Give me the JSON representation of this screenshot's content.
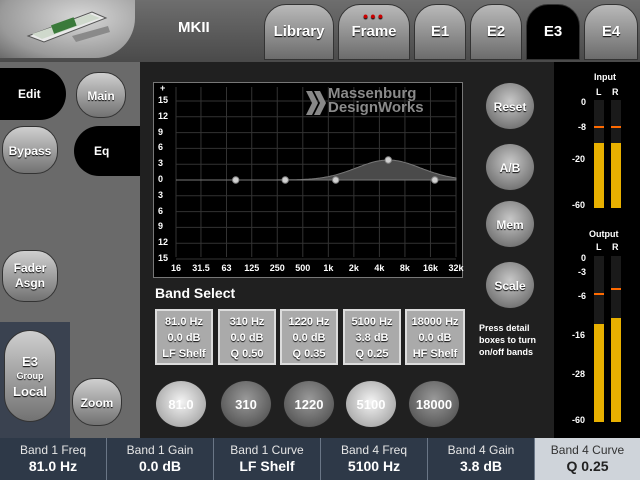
{
  "header": {
    "title": "MKII",
    "tabs": [
      {
        "label": "Library"
      },
      {
        "label": "Frame"
      },
      {
        "label": "E1"
      },
      {
        "label": "E2"
      },
      {
        "label": "E3"
      },
      {
        "label": "E4"
      }
    ]
  },
  "sidebar": {
    "edit": "Edit",
    "main": "Main",
    "bypass": "Bypass",
    "eq": "Eq",
    "fader_line1": "Fader",
    "fader_line2": "Asgn",
    "group_top": "E3",
    "group_mid": "Group",
    "group_bottom": "Local",
    "zoom": "Zoom"
  },
  "graph": {
    "brand_line1": "Massenburg",
    "brand_line2": "DesignWorks",
    "plus": "+",
    "y_ticks": [
      "15",
      "12",
      "9",
      "6",
      "3",
      "0",
      "3",
      "6",
      "9",
      "12",
      "15"
    ],
    "x_ticks": [
      "16",
      "31.5",
      "63",
      "125",
      "250",
      "500",
      "1k",
      "2k",
      "4k",
      "8k",
      "16k",
      "32k"
    ]
  },
  "chart_data": {
    "type": "line",
    "x": [
      16,
      31.5,
      63,
      125,
      250,
      500,
      1000,
      2000,
      4000,
      8000,
      16000,
      32000
    ],
    "y_range": [
      -15,
      15
    ],
    "x_scale": "log",
    "grid": true,
    "nodes": [
      {
        "freq": 81,
        "gain": 0.0
      },
      {
        "freq": 310,
        "gain": 0.0
      },
      {
        "freq": 1220,
        "gain": 0.0
      },
      {
        "freq": 5100,
        "gain": 3.8
      },
      {
        "freq": 18000,
        "gain": 0.0
      }
    ]
  },
  "right_buttons": {
    "reset": "Reset",
    "ab": "A/B",
    "mem": "Mem",
    "scale": "Scale"
  },
  "band_select": {
    "title": "Band Select",
    "hint": "Press detail boxes to turn on/off bands",
    "boxes": [
      {
        "freq": "81.0 Hz",
        "gain": "0.0 dB",
        "curve": "LF Shelf"
      },
      {
        "freq": "310 Hz",
        "gain": "0.0 dB",
        "curve": "Q 0.50"
      },
      {
        "freq": "1220 Hz",
        "gain": "0.0 dB",
        "curve": "Q 0.35"
      },
      {
        "freq": "5100 Hz",
        "gain": "3.8 dB",
        "curve": "Q 0.25"
      },
      {
        "freq": "18000 Hz",
        "gain": "0.0 dB",
        "curve": "HF Shelf"
      }
    ],
    "buttons": [
      "81.0",
      "310",
      "1220",
      "5100",
      "18000"
    ]
  },
  "meters": {
    "input_label": "Input",
    "output_label": "Output",
    "L": "L",
    "R": "R",
    "input_ticks": [
      "0",
      "-8",
      "-20",
      "-60"
    ],
    "output_ticks": [
      "0",
      "-3",
      "-6",
      "-16",
      "-28",
      "-60"
    ]
  },
  "bottom": [
    {
      "label": "Band 1 Freq",
      "value": "81.0 Hz"
    },
    {
      "label": "Band 1 Gain",
      "value": "0.0 dB"
    },
    {
      "label": "Band 1 Curve",
      "value": "LF Shelf"
    },
    {
      "label": "Band 4 Freq",
      "value": "5100 Hz"
    },
    {
      "label": "Band 4 Gain",
      "value": "3.8 dB"
    },
    {
      "label": "Band 4 Curve",
      "value": "Q 0.25"
    }
  ],
  "colors": {
    "meter": "#e8b000",
    "peak": "#ff6a00",
    "active_tab": "#000000",
    "bottom_bar": "#2e3948"
  }
}
